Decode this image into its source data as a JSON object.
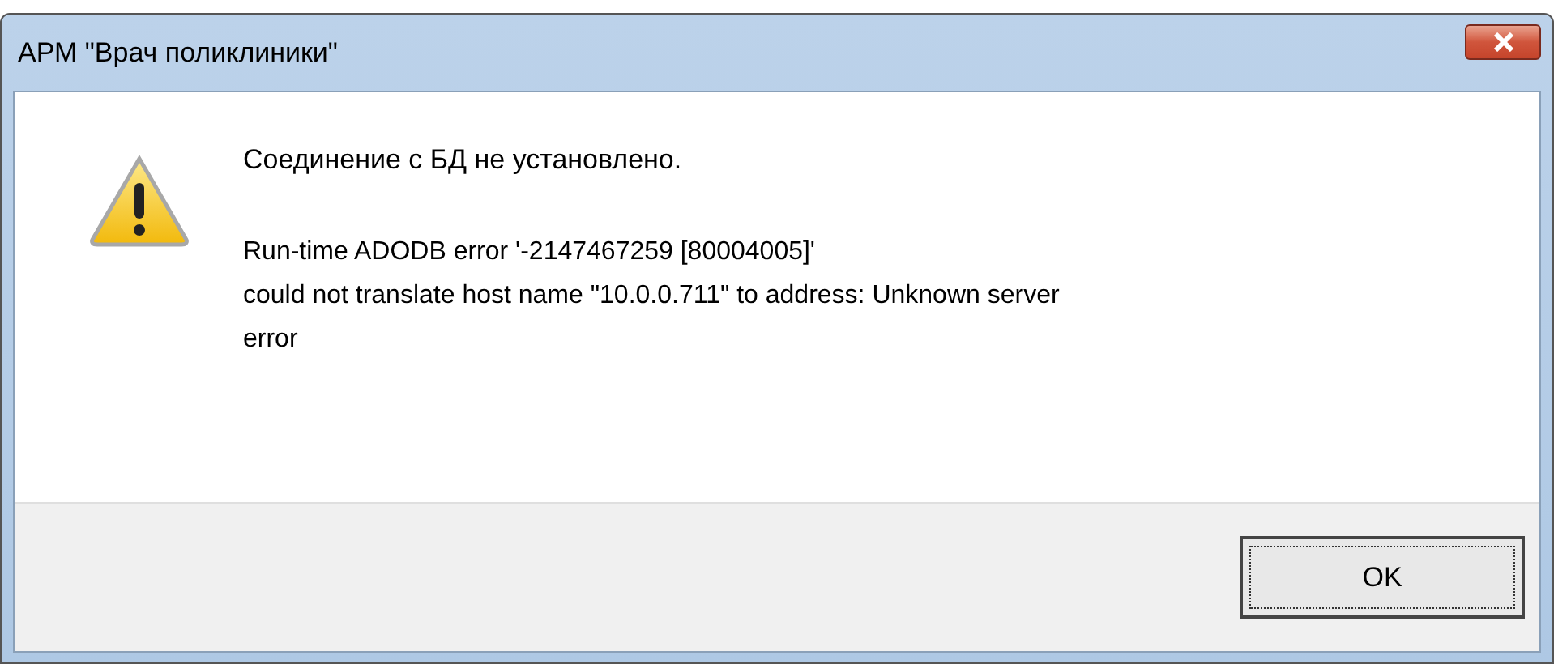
{
  "window": {
    "title": "АРМ \"Врач поликлиники\""
  },
  "message": {
    "heading": "Соединение с БД не установлено.",
    "details": [
      "Run-time ADODB error '-2147467259 [80004005]'",
      "could not translate host name \"10.0.0.711\" to address: Unknown server",
      "error"
    ]
  },
  "buttons": [
    {
      "label": "OK",
      "selected": true
    }
  ]
}
